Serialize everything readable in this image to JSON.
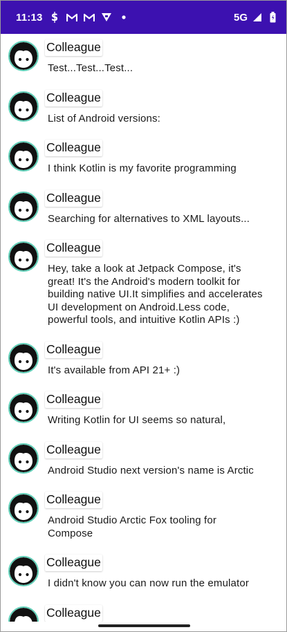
{
  "status_bar": {
    "time": "11:13",
    "network": "5G",
    "color": "#3c11b0",
    "icons": [
      "sim-s-icon",
      "gmail-icon",
      "gmail-icon",
      "download-icon",
      "dot-icon",
      "signal-icon",
      "battery-icon"
    ]
  },
  "messages": [
    {
      "author": "Colleague",
      "text": "Test...Test...Test..."
    },
    {
      "author": "Colleague",
      "text": "List of Android versions:"
    },
    {
      "author": "Colleague",
      "text": "I think Kotlin is my favorite programming"
    },
    {
      "author": "Colleague",
      "text": "Searching for alternatives to XML layouts..."
    },
    {
      "author": "Colleague",
      "text": "Hey, take a look at Jetpack Compose, it's great! It's the Android's modern toolkit for building native UI.It simplifies and accelerates UI development on Android.Less code, powerful tools, and intuitive Kotlin APIs :)"
    },
    {
      "author": "Colleague",
      "text": "It's available from API 21+ :)"
    },
    {
      "author": "Colleague",
      "text": "Writing Kotlin for UI seems so natural,"
    },
    {
      "author": "Colleague",
      "text": "Android Studio next version's name is Arctic"
    },
    {
      "author": "Colleague",
      "text": "Android Studio Arctic Fox tooling for Compose"
    },
    {
      "author": "Colleague",
      "text": "I didn't know you can now run the emulator"
    },
    {
      "author": "Colleague",
      "text": ""
    }
  ],
  "avatar_ring_color": "#5fd0b8"
}
